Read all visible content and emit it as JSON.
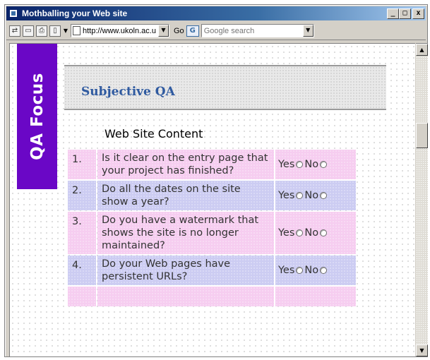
{
  "window": {
    "title": "Mothballing your Web site",
    "minimize_glyph": "_",
    "maximize_glyph": "□",
    "close_glyph": "x"
  },
  "toolbar": {
    "address": "http://www.ukoln.ac.u",
    "go_label": "Go",
    "google_logo": "G",
    "search_placeholder": "Google search"
  },
  "banner": {
    "text": "QA Focus",
    "color": "#6a07c6"
  },
  "page": {
    "section_title": "Subjective QA",
    "subsection": "Web Site Content"
  },
  "questions": [
    {
      "num": "1.",
      "text": "Is it clear on the entry page that your project has finished?",
      "yes": "Yes",
      "no": "No"
    },
    {
      "num": "2.",
      "text": "Do all the dates on the site show a year?",
      "yes": "Yes",
      "no": "No"
    },
    {
      "num": "3.",
      "text": "Do you have a watermark that shows the site is no longer maintained?",
      "yes": "Yes",
      "no": "No"
    },
    {
      "num": "4.",
      "text": "Do your Web pages have persistent URLs?",
      "yes": "Yes",
      "no": "No"
    }
  ],
  "colors": {
    "row_pink": "#f6cdf0",
    "row_blue": "#ccccf2",
    "title_blue": "#2f5aa0"
  }
}
